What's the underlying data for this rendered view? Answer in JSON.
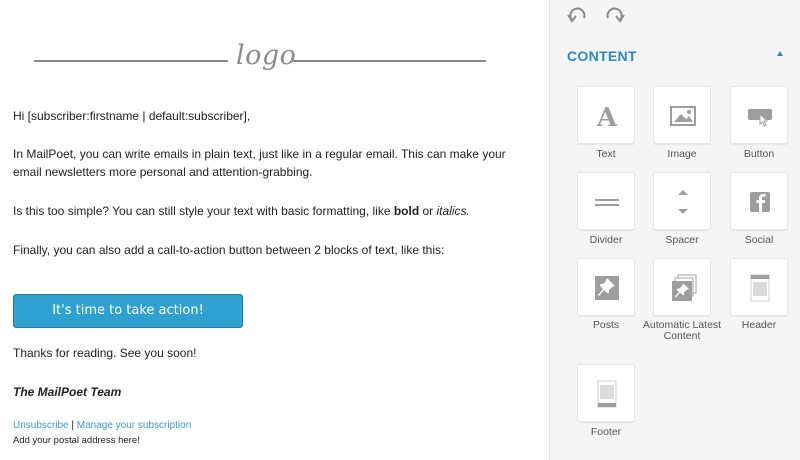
{
  "email": {
    "logo_text": "logo",
    "greeting": "Hi [subscriber:firstname | default:subscriber],",
    "intro": "In MailPoet, you can write emails in plain text, just like in a regular email. This can make your email newsletters more personal and attention-grabbing.",
    "styles_prefix": "Is this too simple? You can still style your text with basic formatting, like ",
    "styles_bold": "bold",
    "styles_or": " or ",
    "styles_italic": "italics.",
    "cta_text": "Finally, you can also add a call-to-action button between 2 blocks of text, like this:",
    "cta_button_label": "It's time to take action!",
    "thanks": "Thanks for reading. See you soon!",
    "signature": "The MailPoet Team",
    "unsubscribe": "Unsubscribe",
    "separator": " | ",
    "manage_subscription": "Manage your subscription",
    "postal_address": "Add your postal address here!"
  },
  "sidebar": {
    "content_title": "CONTENT",
    "blocks": [
      {
        "label": "Text",
        "icon": "text-icon"
      },
      {
        "label": "Image",
        "icon": "image-icon"
      },
      {
        "label": "Button",
        "icon": "button-icon"
      },
      {
        "label": "Divider",
        "icon": "divider-icon"
      },
      {
        "label": "Spacer",
        "icon": "spacer-icon"
      },
      {
        "label": "Social",
        "icon": "social-icon"
      },
      {
        "label": "Posts",
        "icon": "posts-icon"
      },
      {
        "label": "Automatic Latest Content",
        "icon": "automatic-latest-content-icon"
      },
      {
        "label": "Header",
        "icon": "header-icon"
      },
      {
        "label": "Footer",
        "icon": "footer-icon"
      }
    ]
  },
  "colors": {
    "accent": "#2989c4",
    "button_bg": "#2ea1d0",
    "link": "#3a9ccf",
    "icon_gray": "#9e9e9e"
  }
}
